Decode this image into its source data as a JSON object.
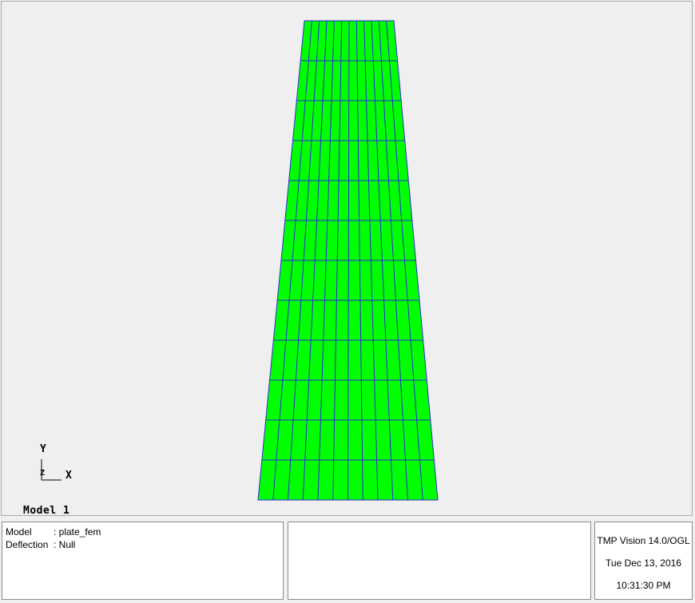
{
  "viewport": {
    "title": "Model 1",
    "background": "#efefef",
    "mesh": {
      "fill_color": "#00ff00",
      "edge_color": "#2b2bd9",
      "columns": 12,
      "rows": 12
    },
    "triad": {
      "x_label": "X",
      "y_label": "Y",
      "z_label": "Z"
    }
  },
  "info_panel": {
    "rows": [
      {
        "key": "Model",
        "value": ": plate_fem"
      },
      {
        "key": "Deflection",
        "value": ": Null"
      }
    ]
  },
  "version_panel": {
    "product": "TMP Vision 14.0/OGL",
    "date": "Tue Dec 13, 2016",
    "time": "10:31:30 PM"
  }
}
